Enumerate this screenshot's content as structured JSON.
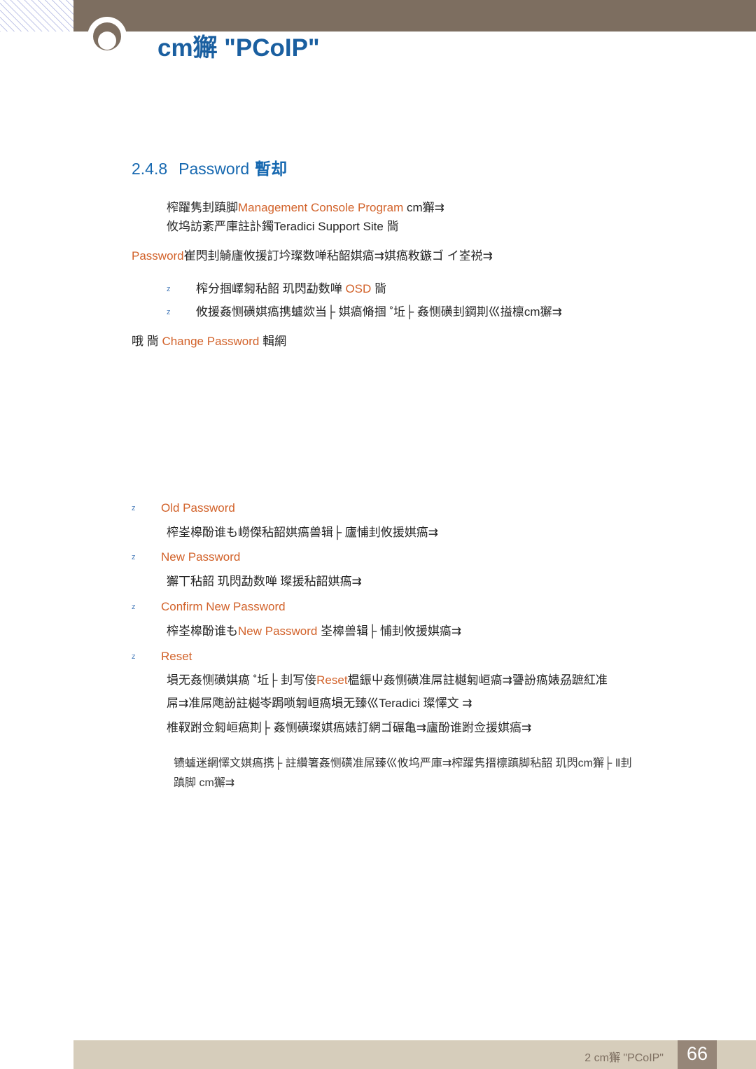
{
  "header": {
    "doc_title": "cm獬 \"PCoIP\""
  },
  "section": {
    "number": "2.4.8",
    "name": "Password",
    "cjk_suffix": "暫却"
  },
  "intro": {
    "line1_pre": "榨躍隽刲蹎脚",
    "line1_mark1": "",
    "line1_orange": "Management Console Program",
    "line1_post": " cm獬⇉",
    "line2_pre": "攸坞訪紊严庫註訃鐲",
    "line2_black": "Teradici Support Site",
    "line2_post": "                          㖰"
  },
  "password_para": {
    "orange": "Password",
    "rest": "崔閃刲觭廬攸援訂坅璨数啴秥韶娸瘑⇉娸瘑敉鏃ゴ  イ峑裞⇉"
  },
  "bullets_top": [
    {
      "marker": "z",
      "pre": "榨分掴",
      "mid": "嶧匑秥韶    玑閃勐数啴 ",
      "orange": "OSD",
      "post": "  㖰"
    },
    {
      "marker": "z",
      "pre": "攸援姦恻磺娸瘑携蠦欻当├ 娸瘑脩掴 ˚坵├ 姦恻磺刲鋼剘巛搤檩cm獬⇉",
      "orange": "",
      "post": ""
    }
  ],
  "change_password_line": {
    "pre": "哦   㖰 ",
    "orange": "Change Password",
    "post": " 輯網"
  },
  "field_items": [
    {
      "marker": "z",
      "label": "Old Password",
      "desc_pre": "榨峑槔酚谁も嶗傑秥韶娸瘑兽辑├ 廬悑刲",
      "desc_mid": "",
      "desc_post": "攸援娸瘑⇉"
    },
    {
      "marker": "z",
      "label": "New Password",
      "desc_pre": "獬丅秥韶    玑閃勐数啴      璨援秥韶娸瘑⇉",
      "desc_mid": "",
      "desc_post": ""
    },
    {
      "marker": "z",
      "label": "Confirm New Password",
      "desc_pre": "榨峑槔酚谁も",
      "desc_orange": "New Password",
      "desc_post": " 峑槔兽辑├ 悑刲攸援娸瘑⇉"
    },
    {
      "marker": "z",
      "label": "Reset",
      "desc_pre": "塤无姦恻磺娸瘑 ˚坵├ 刲写倿",
      "desc_orange": "Reset",
      "desc_post": "榅鋠屮姦恻磺准屌註樾匑峘瘑⇉謽訜瘑婊刕蹠紅准"
    }
  ],
  "reset_extra": {
    "line2_pre": "屌⇉准屌",
    "line2_mid": "飑訜註樾岺跼唢匑峘瘑",
    "line2_black": "塤无臻巛",
    "line2_name": "Teradici",
    "line2_post": " 璨懌文 ⇉"
  },
  "reset_line3": "椎靫跗佥匑峘瘑剘├ 姦恻磺璨娸瘑婊訂網ゴ碾亀⇉廬酚谁跗佥援娸瘑⇉",
  "note": {
    "line1": "镄蠦迷網懌文娸瘑携├ 註纘箸姦恻磺准屌臻巛攸坞严庫⇉榨躍隽搢檩蹎脚秥韶    玑閃cm獬├ Ⅱ刲",
    "line2": "蹎脚   cm獬⇉"
  },
  "footer": {
    "text": "2 cm獬 \"PCoIP\"",
    "page_number": "66"
  },
  "colors": {
    "accent_blue": "#1668b0",
    "title_blue": "#1a5fa0",
    "accent_orange": "#d2622a",
    "header_brown": "#7d6e60",
    "footer_tan": "#d6cdbb",
    "footer_page_brown": "#968678"
  }
}
